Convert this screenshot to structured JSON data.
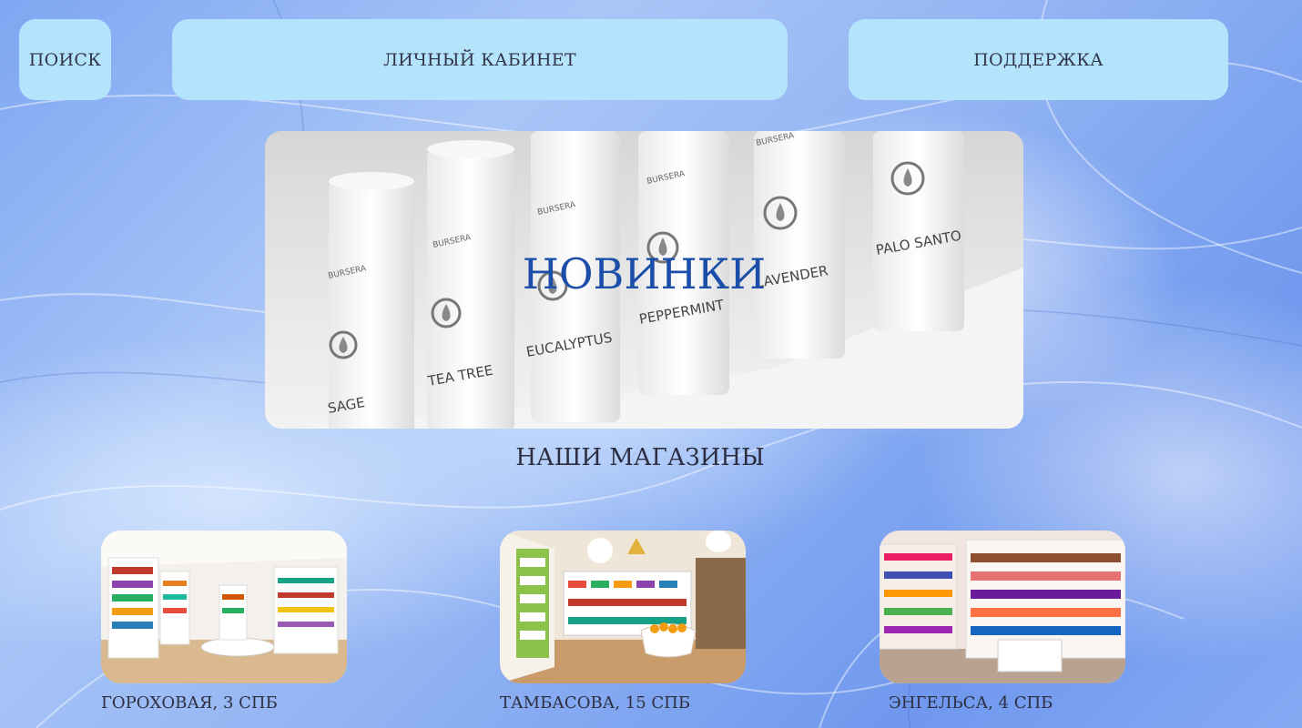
{
  "nav": {
    "search_label": "ПОИСК",
    "account_label": "ЛИЧНЫЙ КАБИНЕТ",
    "support_label": "ПОДДЕРЖКА"
  },
  "hero": {
    "title": "НОВИНКИ",
    "products": [
      "SAGE",
      "TEA TREE",
      "EUCALYPTUS",
      "PEPPERMINT",
      "LAVENDER",
      "PALO SANTO"
    ],
    "brand": "BURSERA"
  },
  "stores_section": {
    "title": "НАШИ МАГАЗИНЫ",
    "stores": [
      {
        "label": "ГОРОХОВАЯ, 3 СПБ"
      },
      {
        "label": "ТАМБАСОВА, 15 СПБ"
      },
      {
        "label": "ЭНГЕЛЬСА, 4 СПБ"
      }
    ]
  },
  "colors": {
    "nav_button_bg": "#b3e4fb",
    "hero_title": "#1a4ea8",
    "text_dark": "#2d2f40",
    "background": "#8fb1f3"
  }
}
